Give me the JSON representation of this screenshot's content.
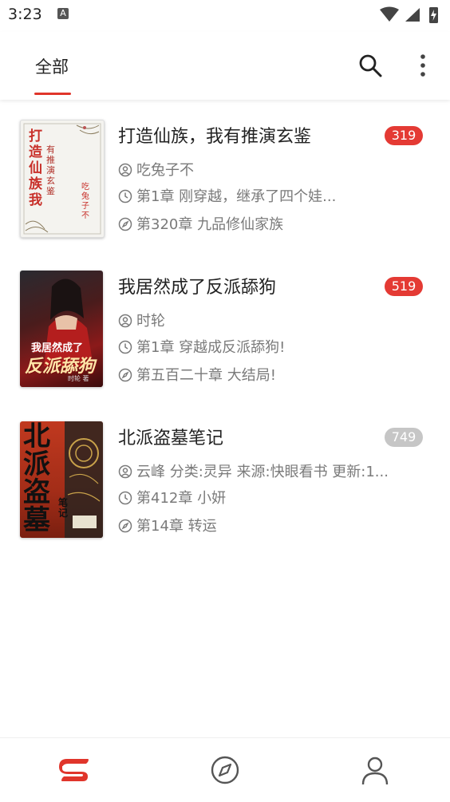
{
  "status_bar": {
    "time": "3:23",
    "notification_letter": "A"
  },
  "header": {
    "tab_all": "全部"
  },
  "books": [
    {
      "title": "打造仙族，我有推演玄鉴",
      "badge": "319",
      "badge_color": "#e43a34",
      "author": "吃兔子不",
      "latest_read": "第1章 刚穿越，继承了四个娃...",
      "last_chapter": "第320章 九品修仙家族",
      "cover_text": {
        "main": "打造仙族我",
        "sub": "有推演玄鉴",
        "author": "吃兔子不"
      }
    },
    {
      "title": "我居然成了反派舔狗",
      "badge": "519",
      "badge_color": "#e43a34",
      "author": "时轮",
      "latest_read": "第1章 穿越成反派舔狗!",
      "last_chapter": "第五百二十章 大结局!",
      "cover_text": {
        "line1": "我居然成了",
        "line2": "反派舔狗",
        "author": "时轮 著"
      }
    },
    {
      "title": "北派盗墓笔记",
      "badge": "749",
      "badge_color": "#c6c6c6",
      "author": "云峰 分类:灵异 来源:快眼看书 更新:1...",
      "latest_read": "第412章 小妍",
      "last_chapter": "第14章 转运",
      "cover_text": {
        "main": "北派盗墓",
        "sub": "笔记"
      }
    }
  ],
  "icons": {
    "author": "person-circle-icon",
    "latest": "clock-icon",
    "chapter": "compass-icon",
    "nav": [
      "bookshelf-icon",
      "discover-icon",
      "profile-icon"
    ]
  },
  "colors": {
    "accent": "#e0352b",
    "badge_active": "#e43a34",
    "badge_inactive": "#c6c6c6"
  }
}
